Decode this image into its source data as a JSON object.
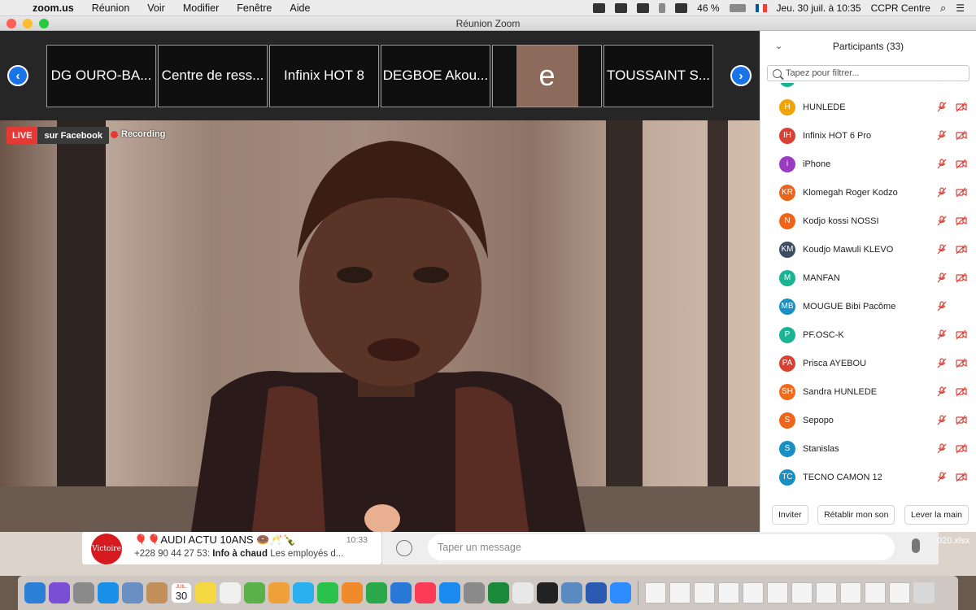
{
  "menubar": {
    "app_name": "zoom.us",
    "menus": [
      "Réunion",
      "Voir",
      "Modifier",
      "Fenêtre",
      "Aide"
    ],
    "battery": "46 %",
    "datetime": "Jeu. 30 juil. à 10:35",
    "user": "CCPR Centre"
  },
  "window": {
    "title": "Réunion Zoom"
  },
  "thumbnails": [
    {
      "label": "DG OURO-BA..."
    },
    {
      "label": "Centre de ress..."
    },
    {
      "label": "Infinix HOT 8"
    },
    {
      "label": "DEGBOE Akou..."
    },
    {
      "label": "e"
    },
    {
      "label": "TOUSSAINT S..."
    }
  ],
  "badges": {
    "live": "LIVE",
    "live_target": "sur Facebook",
    "recording": "Recording"
  },
  "participants_panel": {
    "title": "Participants (33)",
    "filter_placeholder": "Tapez pour filtrer...",
    "list": [
      {
        "initials": "",
        "name": "",
        "color": "#1ab394",
        "mic_muted": true,
        "video_off": true
      },
      {
        "initials": "H",
        "name": "HUNLEDE",
        "color": "#f0a30a",
        "mic_muted": true,
        "video_off": true
      },
      {
        "initials": "IH",
        "name": "Infinix HOT 6 Pro",
        "color": "#d64133",
        "mic_muted": true,
        "video_off": true
      },
      {
        "initials": "i",
        "name": "iPhone",
        "color": "#9b3ac2",
        "mic_muted": true,
        "video_off": true
      },
      {
        "initials": "KR",
        "name": "Klomegah Roger Kodzo",
        "color": "#e8641a",
        "mic_muted": true,
        "video_off": true
      },
      {
        "initials": "N",
        "name": "Kodjo kossi NOSSI",
        "color": "#f0641a",
        "mic_muted": true,
        "video_off": true
      },
      {
        "initials": "KM",
        "name": "Koudjo Mawuli KLEVO",
        "color": "#3d4d63",
        "mic_muted": true,
        "video_off": true
      },
      {
        "initials": "M",
        "name": "MANFAN",
        "color": "#1ab394",
        "mic_muted": true,
        "video_off": true
      },
      {
        "initials": "MB",
        "name": "MOUGUE Bibi Pacôme",
        "color": "#1a8fc2",
        "mic_muted": true,
        "video_off": false
      },
      {
        "initials": "P",
        "name": "PF.OSC-K",
        "color": "#1ab394",
        "mic_muted": true,
        "video_off": true
      },
      {
        "initials": "PA",
        "name": "Prisca AYEBOU",
        "color": "#d64133",
        "mic_muted": true,
        "video_off": true
      },
      {
        "initials": "SH",
        "name": "Sandra HUNLEDE",
        "color": "#f06a1a",
        "mic_muted": true,
        "video_off": true
      },
      {
        "initials": "S",
        "name": "Sepopo",
        "color": "#f0641a",
        "mic_muted": true,
        "video_off": true
      },
      {
        "initials": "S",
        "name": "Stanislas",
        "color": "#1a8fc2",
        "mic_muted": true,
        "video_off": true
      },
      {
        "initials": "TC",
        "name": "TECNO CAMON 12",
        "color": "#1a8fc2",
        "mic_muted": true,
        "video_off": true
      }
    ],
    "buttons": {
      "invite": "Inviter",
      "unmute": "Rétablir mon son",
      "raise_hand": "Lever la main"
    }
  },
  "whatsapp": {
    "chat_name": "🎈🎈AUDI ACTU 10ANS 🍩🥂🍾",
    "chat_time": "10:33",
    "chat_sender": "+228 90 44 27 53:",
    "chat_preview_bold": "Info à chaud",
    "chat_preview": "Les employés d...",
    "avatar_text": "Victoire",
    "compose_placeholder": "Taper un message",
    "file_label": "020.xlsx"
  },
  "dock": {
    "calendar_month": "JUIL.",
    "calendar_day": "30",
    "icons": [
      "finder-icon",
      "siri-icon",
      "launchpad-icon",
      "safari-icon",
      "photo-icon",
      "notes-book-icon",
      "calendar-icon",
      "stickies-icon",
      "reminders-icon",
      "maps-icon",
      "photos-icon",
      "messages-icon",
      "facetime-icon",
      "pages-icon",
      "numbers-icon",
      "keynote-icon",
      "music-icon",
      "appstore-icon",
      "systemprefs-icon",
      "excel-icon",
      "chrome-icon",
      "activity-icon",
      "preview-icon",
      "word-icon",
      "zoom-icon"
    ]
  }
}
